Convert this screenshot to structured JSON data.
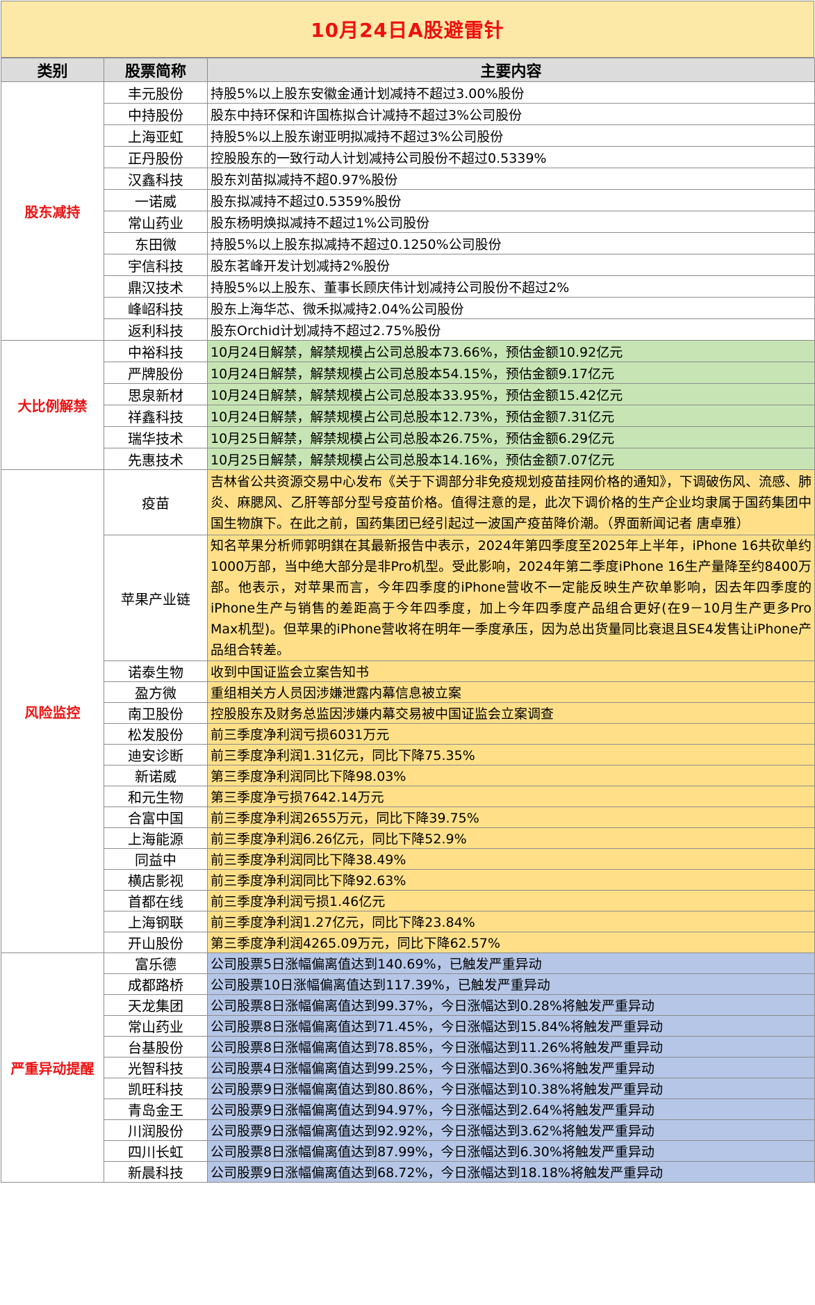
{
  "title": "10月24日A股避雷针",
  "headers": [
    "类别",
    "股票简称",
    "主要内容"
  ],
  "groups": [
    {
      "category": "股东减持",
      "color": "#ffffff",
      "rows": [
        {
          "name": "丰元股份",
          "content": "持股5%以上股东安徽金通计划减持不超过3.00%股份"
        },
        {
          "name": "中持股份",
          "content": "股东中持环保和许国栋拟合计减持不超过3%公司股份"
        },
        {
          "name": "上海亚虹",
          "content": "持股5%以上股东谢亚明拟减持不超过3%公司股份"
        },
        {
          "name": "正丹股份",
          "content": "控股股东的一致行动人计划减持公司股份不超过0.5339%"
        },
        {
          "name": "汉鑫科技",
          "content": "股东刘苗拟减持不超0.97%股份"
        },
        {
          "name": "一诺威",
          "content": "股东拟减持不超过0.5359%股份"
        },
        {
          "name": "常山药业",
          "content": "股东杨明焕拟减持不超过1%公司股份"
        },
        {
          "name": "东田微",
          "content": "持股5%以上股东拟减持不超过0.1250%公司股份"
        },
        {
          "name": "宇信科技",
          "content": "股东茗峰开发计划减持2%股份"
        },
        {
          "name": "鼎汉技术",
          "content": "持股5%以上股东、董事长顾庆伟计划减持公司股份不超过2%"
        },
        {
          "name": "峰岹科技",
          "content": "股东上海华芯、微禾拟减持2.04%公司股份"
        },
        {
          "name": "返利科技",
          "content": "股东Orchid计划减持不超过2.75%股份"
        }
      ]
    },
    {
      "category": "大比例解禁",
      "color": "#c7e5b4",
      "rows": [
        {
          "name": "中裕科技",
          "content": "10月24日解禁，解禁规模占公司总股本73.66%，预估金额10.92亿元"
        },
        {
          "name": "严牌股份",
          "content": "10月24日解禁，解禁规模占公司总股本54.15%，预估金额9.17亿元"
        },
        {
          "name": "思泉新材",
          "content": "10月24日解禁，解禁规模占公司总股本33.95%，预估金额15.42亿元"
        },
        {
          "name": "祥鑫科技",
          "content": "10月24日解禁，解禁规模占公司总股本12.73%，预估金额7.31亿元"
        },
        {
          "name": "瑞华技术",
          "content": "10月25日解禁，解禁规模占公司总股本26.75%，预估金额6.29亿元"
        },
        {
          "name": "先惠技术",
          "content": "10月25日解禁，解禁规模占公司总股本14.16%，预估金额7.07亿元"
        }
      ]
    },
    {
      "category": "风险监控",
      "color": "#ffe089",
      "rows": [
        {
          "name": "疫苗",
          "content": "吉林省公共资源交易中心发布《关于下调部分非免疫规划疫苗挂网价格的通知》，下调破伤风、流感、肺炎、麻腮风、乙肝等部分型号疫苗价格。值得注意的是，此次下调价格的生产企业均隶属于国药集团中国生物旗下。在此之前，国药集团已经引起过一波国产疫苗降价潮。（界面新闻记者 唐卓雅）"
        },
        {
          "name": "苹果产业链",
          "content": "知名苹果分析师郭明錤在其最新报告中表示，2024年第四季度至2025年上半年，iPhone 16共砍单约1000万部，当中绝大部分是非Pro机型。受此影响，2024年第二季度iPhone 16生产量降至约8400万部。他表示，对苹果而言，今年四季度的iPhone营收不一定能反映生产砍单影响，因去年四季度的iPhone生产与销售的差距高于今年四季度，加上今年四季度产品组合更好(在9－10月生产更多Pro Max机型)。但苹果的iPhone营收将在明年一季度承压，因为总出货量同比衰退且SE4发售让iPhone产品组合转差。"
        },
        {
          "name": "诺泰生物",
          "content": "收到中国证监会立案告知书"
        },
        {
          "name": "盈方微",
          "content": "重组相关方人员因涉嫌泄露内幕信息被立案"
        },
        {
          "name": "南卫股份",
          "content": "控股股东及财务总监因涉嫌内幕交易被中国证监会立案调查"
        },
        {
          "name": "松发股份",
          "content": "前三季度净利润亏损6031万元"
        },
        {
          "name": "迪安诊断",
          "content": "前三季度净利润1.31亿元，同比下降75.35%"
        },
        {
          "name": "新诺威",
          "content": "第三季度净利润同比下降98.03%"
        },
        {
          "name": "和元生物",
          "content": "第三季度净亏损7642.14万元"
        },
        {
          "name": "合富中国",
          "content": "前三季度净利润2655万元，同比下降39.75%"
        },
        {
          "name": "上海能源",
          "content": "前三季度净利润6.26亿元，同比下降52.9%"
        },
        {
          "name": "同益中",
          "content": "前三季度净利润同比下降38.49%"
        },
        {
          "name": "横店影视",
          "content": "前三季度净利润同比下降92.63%"
        },
        {
          "name": "首都在线",
          "content": "前三季度净利润亏损1.46亿元"
        },
        {
          "name": "上海钢联",
          "content": "前三季度净利润1.27亿元，同比下降23.84%"
        },
        {
          "name": "开山股份",
          "content": "第三季度净利润4265.09万元，同比下降62.57%"
        }
      ]
    },
    {
      "category": "严重异动提醒",
      "color": "#b5c6e7",
      "rows": [
        {
          "name": "富乐德",
          "content": "公司股票5日涨幅偏离值达到140.69%，已触发严重异动"
        },
        {
          "name": "成都路桥",
          "content": "公司股票10日涨幅偏离值达到117.39%，已触发严重异动"
        },
        {
          "name": "天龙集团",
          "content": "公司股票8日涨幅偏离值达到99.37%，今日涨幅达到0.28%将触发严重异动"
        },
        {
          "name": "常山药业",
          "content": "公司股票8日涨幅偏离值达到71.45%，今日涨幅达到15.84%将触发严重异动"
        },
        {
          "name": "台基股份",
          "content": "公司股票8日涨幅偏离值达到78.85%，今日涨幅达到11.26%将触发严重异动"
        },
        {
          "name": "光智科技",
          "content": "公司股票4日涨幅偏离值达到99.25%，今日涨幅达到0.36%将触发严重异动"
        },
        {
          "name": "凯旺科技",
          "content": "公司股票9日涨幅偏离值达到80.86%，今日涨幅达到10.38%将触发严重异动"
        },
        {
          "name": "青岛金王",
          "content": "公司股票9日涨幅偏离值达到94.97%，今日涨幅达到2.64%将触发严重异动"
        },
        {
          "name": "川润股份",
          "content": "公司股票9日涨幅偏离值达到92.92%，今日涨幅达到3.62%将触发严重异动"
        },
        {
          "name": "四川长虹",
          "content": "公司股票8日涨幅偏离值达到87.99%，今日涨幅达到6.30%将触发严重异动"
        },
        {
          "name": "新晨科技",
          "content": "公司股票9日涨幅偏离值达到68.72%，今日涨幅达到18.18%将触发严重异动"
        }
      ]
    }
  ]
}
